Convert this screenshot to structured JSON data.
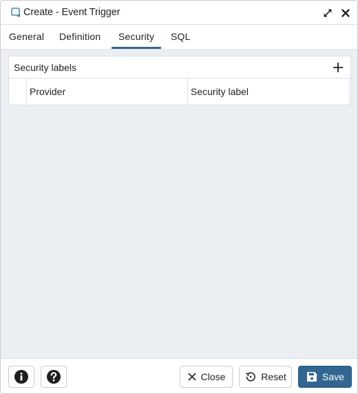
{
  "window": {
    "title": "Create - Event Trigger",
    "title_icon": "event-trigger-icon",
    "maximize_icon": "maximize-icon",
    "close_icon": "close-icon"
  },
  "tabs": [
    {
      "label": "General",
      "active": false
    },
    {
      "label": "Definition",
      "active": false
    },
    {
      "label": "Security",
      "active": true
    },
    {
      "label": "SQL",
      "active": false
    }
  ],
  "security_labels": {
    "title": "Security labels",
    "add_icon": "plus-icon",
    "columns": [
      "Provider",
      "Security label"
    ],
    "rows": []
  },
  "footer": {
    "info_icon": "info-icon",
    "help_icon": "help-icon",
    "close_label": "Close",
    "reset_label": "Reset",
    "save_label": "Save"
  },
  "colors": {
    "accent": "#326690",
    "content_bg": "#ebeef3",
    "border": "#dde0e6"
  }
}
